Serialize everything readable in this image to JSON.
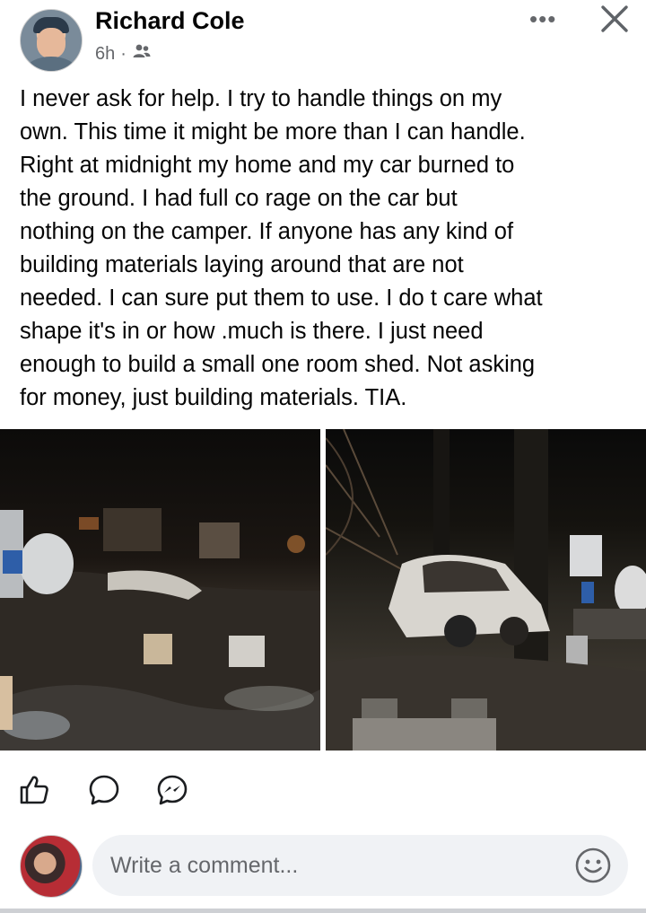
{
  "post": {
    "author": "Richard Cole",
    "time": "6h",
    "separator": "·",
    "audience_icon": "friends-icon",
    "text": "I never ask for help. I try to handle things on my\nown. This time it might be more than I can handle.\nRight at midnight my home and my car burned to\nthe ground. I had full co rage on the car  but\nnothing on the camper. If anyone has any kind of\nbuilding materials laying around that are not\nneeded. I can sure put them to use. I do t care what\nshape it's in or how .much is there. I just need\nenough to build a small one room shed. Not asking\nfor money, just  building materials. TIA."
  },
  "header": {
    "more_label": "•••",
    "close_icon": "close-icon"
  },
  "actions": {
    "like_icon": "thumbs-up-icon",
    "comment_icon": "comment-bubble-icon",
    "share_icon": "messenger-icon"
  },
  "comment": {
    "placeholder": "Write a comment...",
    "emoji_icon": "emoji-icon"
  },
  "colors": {
    "text": "#050505",
    "secondary": "#65676b",
    "input_bg": "#f0f2f5"
  }
}
